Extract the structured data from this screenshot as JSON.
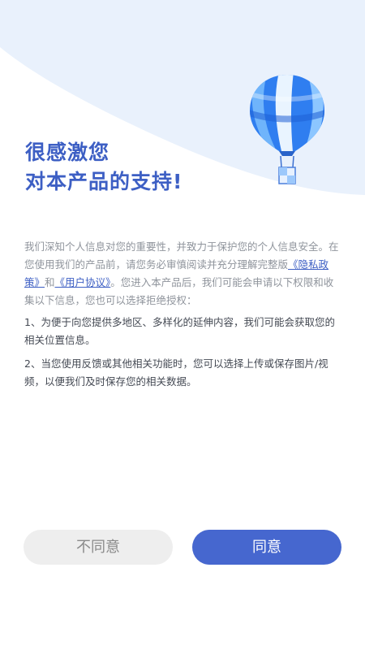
{
  "header": {
    "title_line1": "很感激您",
    "title_line2": "对本产品的支持!"
  },
  "content": {
    "intro_part1": "我们深知个人信息对您的重要性，并致力于保护您的个人信息安全。在您使用我们的产品前，请您务必审慎阅读并充分理解完整版",
    "privacy_link": "《隐私政策》",
    "and_text": "和",
    "user_agreement_link": "《用户协议》",
    "intro_part2": "。您进入本产品后，我们可能会申请以下权限和收集以下信息，您也可以选择拒绝授权：",
    "items": [
      "1、为便于向您提供多地区、多样化的延伸内容，我们可能会获取您的相关位置信息。",
      "2、当您使用反馈或其他相关功能时，您可以选择上传或保存图片/视频，以便我们及时保存您的相关数据。"
    ]
  },
  "buttons": {
    "disagree": "不同意",
    "agree": "同意"
  },
  "colors": {
    "accent": "#4667cf",
    "title": "#3d5fc4",
    "background_curve": "#e9f1fc"
  },
  "icons": {
    "illustration": "hot-air-balloon-icon"
  }
}
